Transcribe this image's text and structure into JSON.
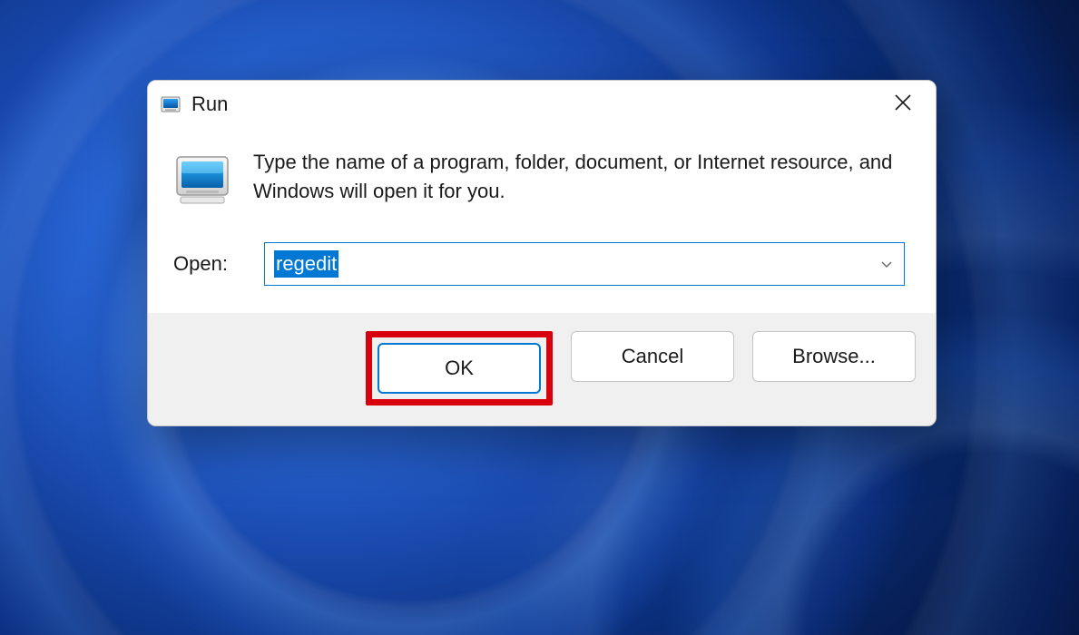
{
  "dialog": {
    "title": "Run",
    "description": "Type the name of a program, folder, document, or Internet resource, and Windows will open it for you.",
    "open_label": "Open:",
    "input_value": "regedit",
    "buttons": {
      "ok": "OK",
      "cancel": "Cancel",
      "browse": "Browse..."
    }
  },
  "highlight": {
    "target": "ok-button",
    "color": "#d8000c"
  }
}
